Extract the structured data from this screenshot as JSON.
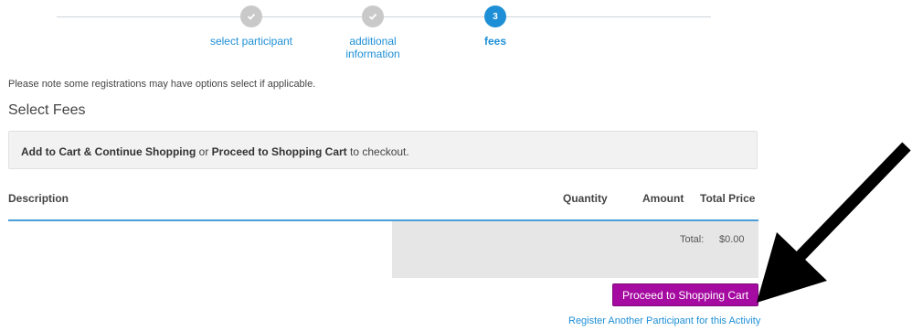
{
  "stepper": {
    "steps": [
      {
        "label": "select participant",
        "status": "done",
        "icon": "check-icon"
      },
      {
        "label": "additional information",
        "status": "done",
        "icon": "check-icon"
      },
      {
        "label": "fees",
        "status": "active",
        "number": "3"
      }
    ]
  },
  "note": "Please note some registrations may have options select if applicable.",
  "section_title": "Select Fees",
  "info": {
    "part1": "Add to Cart & Continue Shopping",
    "part2": " or ",
    "part3": "Proceed to Shopping Cart",
    "part4": " to checkout."
  },
  "table": {
    "headers": [
      "Description",
      "Quantity",
      "Amount",
      "Total Price"
    ],
    "total_label": "Total:",
    "total_value": "$0.00"
  },
  "actions": {
    "proceed_label": "Proceed to Shopping Cart",
    "register_link": "Register Another Participant for this Activity"
  },
  "colors": {
    "accent": "#1e8fd6",
    "button": "#a50ba0",
    "step_done": "#c9c9c9"
  }
}
